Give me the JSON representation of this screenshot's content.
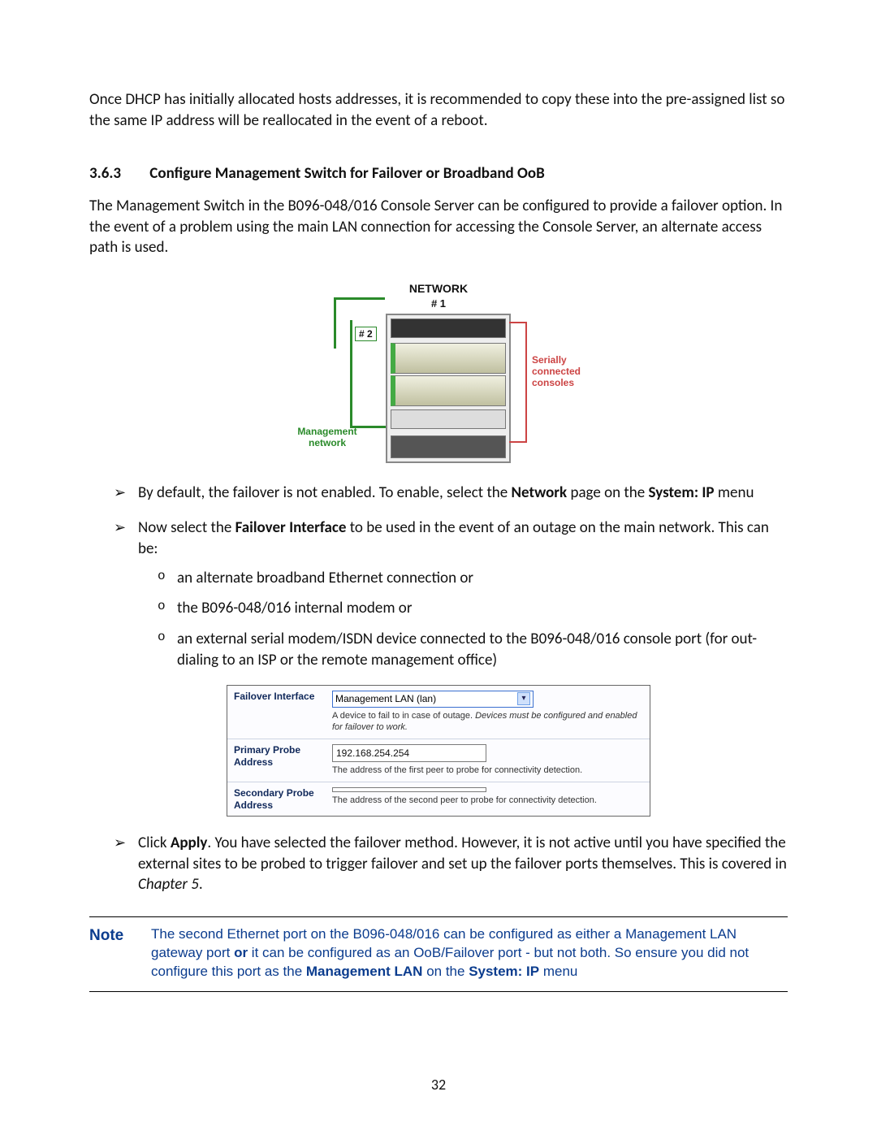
{
  "intro_para": "Once DHCP has initially allocated hosts addresses, it is recommended to copy these into the pre-assigned list so the same IP address will be reallocated in the event of a reboot.",
  "section": {
    "num": "3.6.3",
    "title": "Configure Management Switch for Failover or Broadband OoB"
  },
  "section_para": "The Management Switch in the B096-048/016 Console Server can be configured to provide a failover option. In the event of a problem using the main LAN connection for accessing the Console Server, an alternate access path is used.",
  "rack": {
    "title": "NETWORK",
    "n1": "# 1",
    "n2": "# 2",
    "mgmt": "Management network",
    "serial": "Serially connected consoles"
  },
  "bullets": {
    "b1_pre": "By default, the failover is not enabled. To enable, select the ",
    "b1_bold1": "Network",
    "b1_mid": " page on the ",
    "b1_bold2": "System: IP",
    "b1_post": " menu",
    "b2_pre": "Now select the ",
    "b2_bold": "Failover Interface",
    "b2_post": " to be used in the event of an outage on the main network. This can be:",
    "b2_sub1": "an alternate broadband Ethernet connection or",
    "b2_sub2": "the B096-048/016  internal modem or",
    "b2_sub3": "an external serial modem/ISDN device connected to the B096-048/016 console port (for out-dialing to an ISP or the remote management office)",
    "b3_pre": "Click ",
    "b3_bold": "Apply",
    "b3_mid": ". You have selected the failover method. However, it is not active until you have specified the external sites to be probed to trigger failover and set up the failover ports themselves. This is covered in ",
    "b3_ital": "Chapter 5",
    "b3_post": "."
  },
  "form": {
    "row1_label": "Failover Interface",
    "row1_value": "Management LAN (lan)",
    "row1_help_plain": "A device to fail to in case of outage. ",
    "row1_help_ital": "Devices must be configured and enabled for failover to work.",
    "row2_label": "Primary Probe Address",
    "row2_value": "192.168.254.254",
    "row2_help": "The address of the first peer to probe for connectivity detection.",
    "row3_label": "Secondary Probe Address",
    "row3_value": "",
    "row3_help": "The address of the second peer to probe for connectivity detection."
  },
  "note": {
    "tag": "Note",
    "t1": "The second Ethernet port on the B096-048/016 can be configured as either a Management LAN gateway port ",
    "t2_bold": "or",
    "t3": " it can be configured as an OoB/Failover port - but not both. So ensure you did not configure this port as the ",
    "t4_bold": "Management LAN",
    "t5": " on the ",
    "t6_bold": "System: IP",
    "t7": " menu"
  },
  "page_number": "32"
}
